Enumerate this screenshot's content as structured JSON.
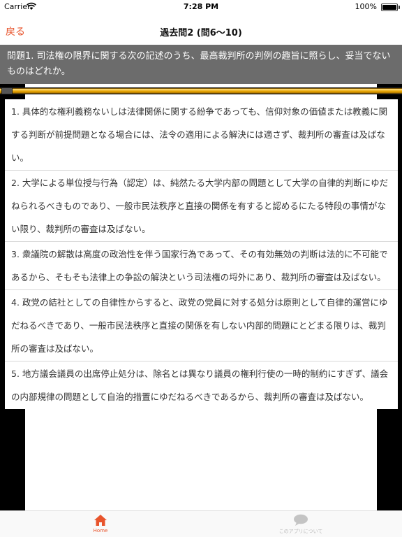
{
  "status_bar": {
    "carrier": "Carrier",
    "time": "7:28 PM",
    "battery": "100%"
  },
  "nav": {
    "back_label": "戻る",
    "title": "過去問2 (問6〜10)"
  },
  "question": {
    "text": "問題1. 司法権の限界に関する次の記述のうち、最高裁判所の判例の趣旨に照らし、妥当でないものはどれか。"
  },
  "progress": {
    "value": 0.0
  },
  "options": [
    "1. 具体的な権利義務ないしは法律関係に関する紛争であっても、信仰対象の価値または教義に関する判断が前提問題となる場合には、法令の適用による解決には適さず、裁判所の審査は及ばない。",
    "2. 大学による単位授与行為（認定）は、純然たる大学内部の問題として大学の自律的判断にゆだねられるべきものであり、一般市民法秩序と直接の関係を有すると認めるにたる特段の事情がない限り、裁判所の審査は及ばない。",
    "3. 衆議院の解散は高度の政治性を伴う国家行為であって、その有効無効の判断は法的に不可能であるから、そもそも法律上の争訟の解決という司法権の埒外にあり、裁判所の審査は及ばない。",
    "4. 政党の結社としての自律性からすると、政党の党員に対する処分は原則として自律的運営にゆだねるべきであり、一般市民法秩序と直接の関係を有しない内部的問題にとどまる限りは、裁判所の審査は及ばない。",
    "5. 地方議会議員の出席停止処分は、除名とは異なり議員の権利行使の一時的制約にすぎず、議会の内部規律の問題として自治的措置にゆだねるべきであるから、裁判所の審査は及ばない。"
  ],
  "tabs": {
    "home": "Home",
    "about": "このアプリについて"
  },
  "colors": {
    "accent": "#e8542c",
    "question_bg": "#6c6c6c",
    "progress_gold": "#e8a400"
  },
  "icons": {
    "wifi": "wifi-icon",
    "home": "home-icon",
    "about": "speech-bubble-icon"
  }
}
